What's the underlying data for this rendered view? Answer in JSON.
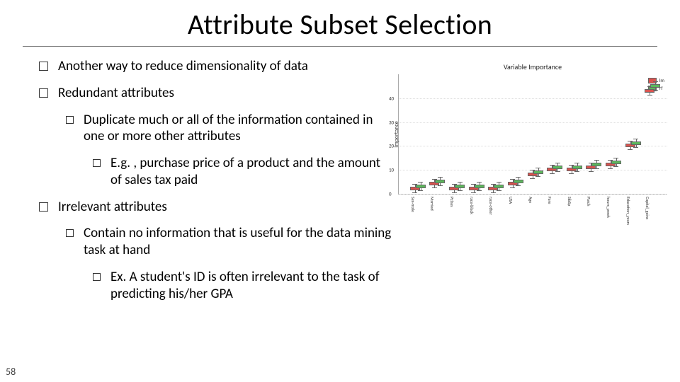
{
  "title": "Attribute Subset Selection",
  "page_number": "58",
  "bullets": {
    "b1": "Another way to reduce dimensionality of data",
    "b2": "Redundant attributes",
    "b2a": "Duplicate much or all of the information contained in one or more other attributes",
    "b2b": "E.g. , purchase price of a product and the amount of sales tax paid",
    "b3": "Irrelevant attributes",
    "b3a": "Contain no information that is useful for the data mining task at hand",
    "b3b": "Ex. A student's ID is often irrelevant to the task of predicting his/her GPA"
  },
  "chart_data": {
    "type": "bar",
    "title": "Variable Importance",
    "ylabel": "Importance",
    "ylim": [
      0,
      50
    ],
    "yticks": [
      0,
      10,
      20,
      30,
      40
    ],
    "legend": [
      "lm",
      "rf"
    ],
    "categories": [
      "Sex-male",
      "Married",
      "Pclass",
      "race-black",
      "race-other",
      "USA",
      "Age",
      "Fare",
      "SibSp",
      "Parch",
      "hours_pwek",
      "Education_years",
      "Capital_gains"
    ],
    "series": [
      {
        "name": "lm",
        "values": [
          2,
          4,
          2,
          2,
          2,
          4,
          8,
          10,
          10,
          11,
          12,
          20,
          43
        ],
        "color": "#d9534f"
      },
      {
        "name": "rf",
        "values": [
          3,
          5,
          3,
          3,
          3,
          5,
          9,
          11,
          11,
          12,
          13,
          21,
          45
        ],
        "color": "#5cb85c"
      }
    ]
  }
}
